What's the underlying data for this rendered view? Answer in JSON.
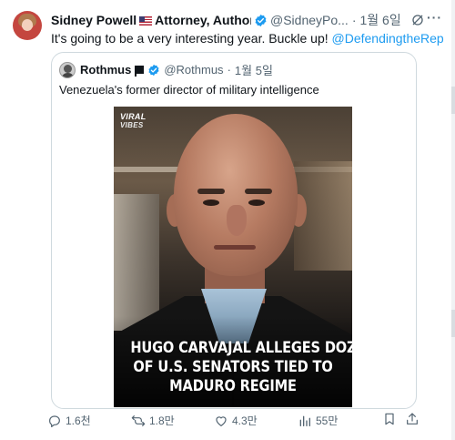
{
  "tweet": {
    "author": {
      "name": "Sidney Powell",
      "title": "Attorney, Author, Gl...",
      "handle": "@SidneyPo...",
      "date": "1월 6일"
    },
    "text_before": "It's going to be a very interesting year. Buckle up! ",
    "text_link": "@DefendingtheRep",
    "more": "···"
  },
  "quote": {
    "name": "Rothmus",
    "handle": "@Rothmus",
    "date": "1월 5일",
    "text": "Venezuela's former director of military intelligence",
    "media": {
      "brand_line1": "VIRAL",
      "brand_line2": "VIBES",
      "headline": [
        "HUGO CARVAJAL ALLEGES DOZENS",
        "OF U.S. SENATORS TIED TO",
        "MADURO REGIME"
      ]
    }
  },
  "actions": {
    "replies": "1.6천",
    "reposts": "1.8만",
    "likes": "4.3만",
    "views": "55만"
  },
  "icons": [
    "verified-badge-icon",
    "grok-icon",
    "more-icon",
    "reply-icon",
    "repost-icon",
    "like-icon",
    "views-icon",
    "bookmark-icon",
    "share-icon"
  ],
  "colors": {
    "accent": "#1d9bf0",
    "muted": "#536471",
    "border": "#cfd9de",
    "text": "#0f1419"
  }
}
